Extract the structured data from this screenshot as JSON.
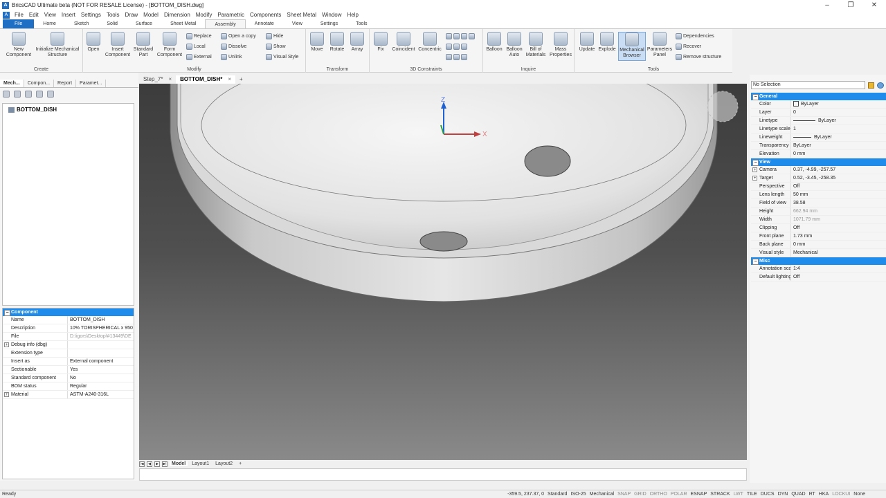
{
  "window": {
    "title": "BricsCAD Ultimate beta (NOT FOR RESALE License) - [BOTTOM_DISH.dwg]"
  },
  "menu": [
    "File",
    "Edit",
    "View",
    "Insert",
    "Settings",
    "Tools",
    "Draw",
    "Model",
    "Dimension",
    "Modify",
    "Parametric",
    "Components",
    "Sheet Metal",
    "Window",
    "Help"
  ],
  "ribbon_tabs": [
    "File",
    "Home",
    "Sketch",
    "Solid",
    "Surface",
    "Sheet Metal",
    "Assembly",
    "Annotate",
    "View",
    "Settings",
    "Tools"
  ],
  "ribbon": {
    "create": {
      "label": "Create",
      "new_component": "New Component",
      "init_mech": "Initialize Mechanical Structure"
    },
    "modify": {
      "label": "Modify",
      "open": "Open",
      "insert_component": "Insert Component",
      "standard_part": "Standard Part",
      "form_component": "Form Component",
      "replace": "Replace",
      "local": "Local",
      "external": "External",
      "open_copy": "Open a copy",
      "dissolve": "Dissolve",
      "unlink": "Unlink",
      "hide": "Hide",
      "show": "Show",
      "visual_style": "Visual Style"
    },
    "transform": {
      "label": "Transform",
      "move": "Move",
      "rotate": "Rotate",
      "array": "Array"
    },
    "constraints": {
      "label": "3D Constraints",
      "fix": "Fix",
      "coincident": "Coincident",
      "concentric": "Concentric"
    },
    "inquire": {
      "label": "Inquire",
      "balloon": "Balloon",
      "balloon_auto": "Balloon Auto",
      "bom": "Bill of Materials",
      "mass_props": "Mass Properties"
    },
    "tools": {
      "label": "Tools",
      "update": "Update",
      "explode": "Explode",
      "mech_browser": "Mechanical Browser",
      "param_panel": "Parameters Panel",
      "dependencies": "Dependencies",
      "recover": "Recover",
      "remove_structure": "Remove structure"
    }
  },
  "left_panel": {
    "tabs": [
      "Mech...",
      "Compon...",
      "Report",
      "Paramet..."
    ],
    "tree_root": "BOTTOM_DISH",
    "props_header": "Component",
    "props": [
      {
        "k": "Name",
        "v": "BOTTOM_DISH"
      },
      {
        "k": "Description",
        "v": "10% TORISPHERICAL x 950"
      },
      {
        "k": "File",
        "v": "D:\\igors\\Desktop\\#13449\\DE"
      },
      {
        "k": "Debug info (dbg)",
        "v": ""
      },
      {
        "k": "Extension type",
        "v": ""
      },
      {
        "k": "Insert as",
        "v": "External component"
      },
      {
        "k": "Sectionable",
        "v": "Yes"
      },
      {
        "k": "Standard component",
        "v": "No"
      },
      {
        "k": "BOM status",
        "v": "Regular"
      },
      {
        "k": "Material",
        "v": "ASTM-A240-316L"
      }
    ]
  },
  "doc_tabs": [
    {
      "label": "Step_7*"
    },
    {
      "label": "BOTTOM_DISH*"
    }
  ],
  "viewport": {
    "axis_x": "X",
    "axis_z": "Z"
  },
  "layout_tabs": [
    "Model",
    "Layout1",
    "Layout2"
  ],
  "right_panel": {
    "selection": "No Selection",
    "sections": [
      {
        "title": "General",
        "rows": [
          {
            "k": "Color",
            "v": "ByLayer"
          },
          {
            "k": "Layer",
            "v": "0"
          },
          {
            "k": "Linetype",
            "v": "ByLayer"
          },
          {
            "k": "Linetype scale",
            "v": "1"
          },
          {
            "k": "Lineweight",
            "v": "ByLayer"
          },
          {
            "k": "Transparency",
            "v": "ByLayer"
          },
          {
            "k": "Elevation",
            "v": "0 mm"
          }
        ]
      },
      {
        "title": "View",
        "rows": [
          {
            "k": "Camera",
            "v": "0.37, -4.99, -257.57"
          },
          {
            "k": "Target",
            "v": "0.52, -3.45, -258.35"
          },
          {
            "k": "Perspective",
            "v": "Off"
          },
          {
            "k": "Lens length",
            "v": "50 mm"
          },
          {
            "k": "Field of view",
            "v": "38.58"
          },
          {
            "k": "Height",
            "v": "662.94 mm"
          },
          {
            "k": "Width",
            "v": "1071.79 mm"
          },
          {
            "k": "Clipping",
            "v": "Off"
          },
          {
            "k": "Front plane",
            "v": "1.73 mm"
          },
          {
            "k": "Back plane",
            "v": "0 mm"
          },
          {
            "k": "Visual style",
            "v": "Mechanical"
          }
        ]
      },
      {
        "title": "Misc",
        "rows": [
          {
            "k": "Annotation scale",
            "v": "1:4"
          },
          {
            "k": "Default lighting",
            "v": "Off"
          }
        ]
      }
    ]
  },
  "status": {
    "ready": "Ready",
    "coords": "-359.5, 237.37, 0",
    "items": [
      "Standard",
      "ISO-25",
      "Mechanical",
      "SNAP",
      "GRID",
      "ORTHO",
      "POLAR",
      "ESNAP",
      "STRACK",
      "LWT",
      "TILE",
      "DUCS",
      "DYN",
      "QUAD",
      "RT",
      "HKA",
      "LOCKUI",
      "None"
    ]
  }
}
